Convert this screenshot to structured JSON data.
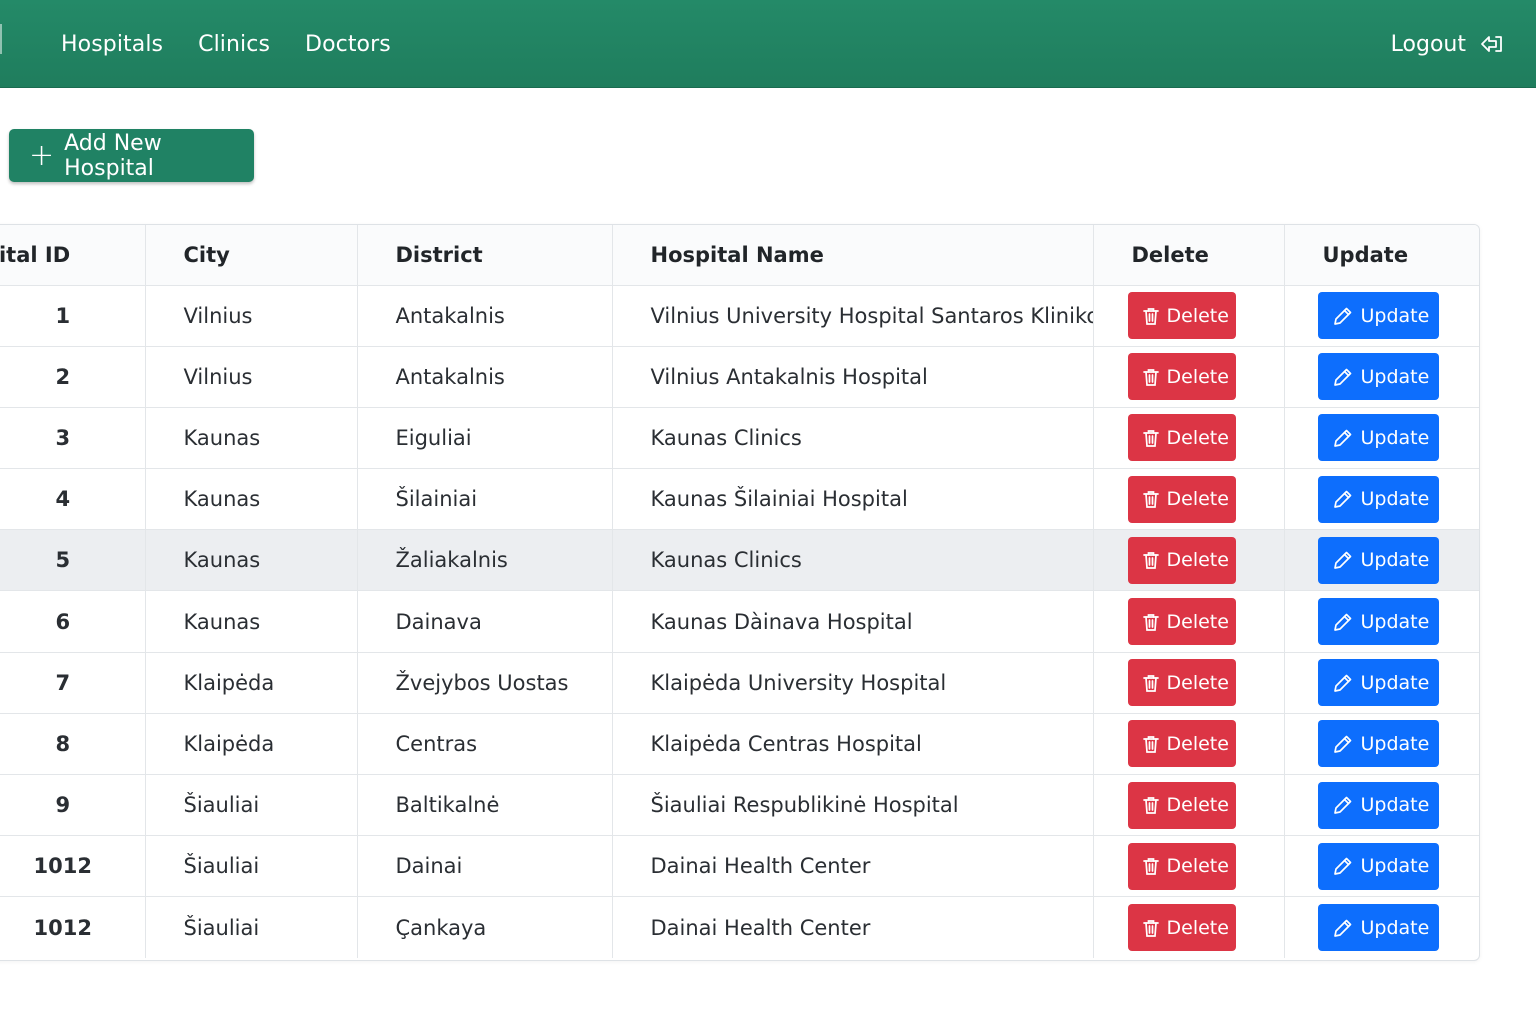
{
  "nav": {
    "links": [
      "Hospitals",
      "Clinics",
      "Doctors"
    ],
    "logout_label": "Logout"
  },
  "actions": {
    "add_label": "Add New Hospital"
  },
  "table": {
    "headers": [
      "ospital ID",
      "City",
      "District",
      "Hospital Name",
      "Delete",
      "Update"
    ],
    "rows": [
      {
        "id": "1",
        "city": "Vilnius",
        "district": "Antakalnis",
        "name": "Vilnius University Hospital Santaros Klinikos"
      },
      {
        "id": "2",
        "city": "Vilnius",
        "district": "Antakalnis",
        "name": "Vilnius Antakalnis Hospital"
      },
      {
        "id": "3",
        "city": "Kaunas",
        "district": "Eiguliai",
        "name": "Kaunas Clinics"
      },
      {
        "id": "4",
        "city": "Kaunas",
        "district": "Šilainiai",
        "name": "Kaunas Šilainiai Hospital"
      },
      {
        "id": "5",
        "city": "Kaunas",
        "district": "Žaliakalnis",
        "name": "Kaunas Clinics"
      },
      {
        "id": "6",
        "city": "Kaunas",
        "district": "Dainava",
        "name": "Kaunas Dàinava Hospital"
      },
      {
        "id": "7",
        "city": "Klaipėda",
        "district": "Žvejybos Uostas",
        "name": "Klaipėda University Hospital"
      },
      {
        "id": "8",
        "city": "Klaipėda",
        "district": "Centras",
        "name": "Klaipėda Centras Hospital"
      },
      {
        "id": "9",
        "city": "Šiauliai",
        "district": "Baltikalnė",
        "name": "Šiauliai Respublikinė Hospital"
      },
      {
        "id": "1012",
        "city": "Šiauliai",
        "district": "Dainai",
        "name": "Dainai Health Center"
      },
      {
        "id": "1012",
        "city": "Šiauliai",
        "district": "Çankaya",
        "name": "Dainai Health Center"
      }
    ],
    "delete_label": "Delete",
    "update_label": "Update",
    "highlighted_row_index": 4
  },
  "colors": {
    "navbar": "#248a68",
    "add_button": "#208264",
    "delete_button": "#dc3545",
    "update_button": "#0d6efd",
    "highlight_row": "#eceef1"
  },
  "icons": {
    "logout": "logout-icon",
    "add": "plus-icon",
    "delete": "trash-icon",
    "update": "pencil-icon"
  }
}
